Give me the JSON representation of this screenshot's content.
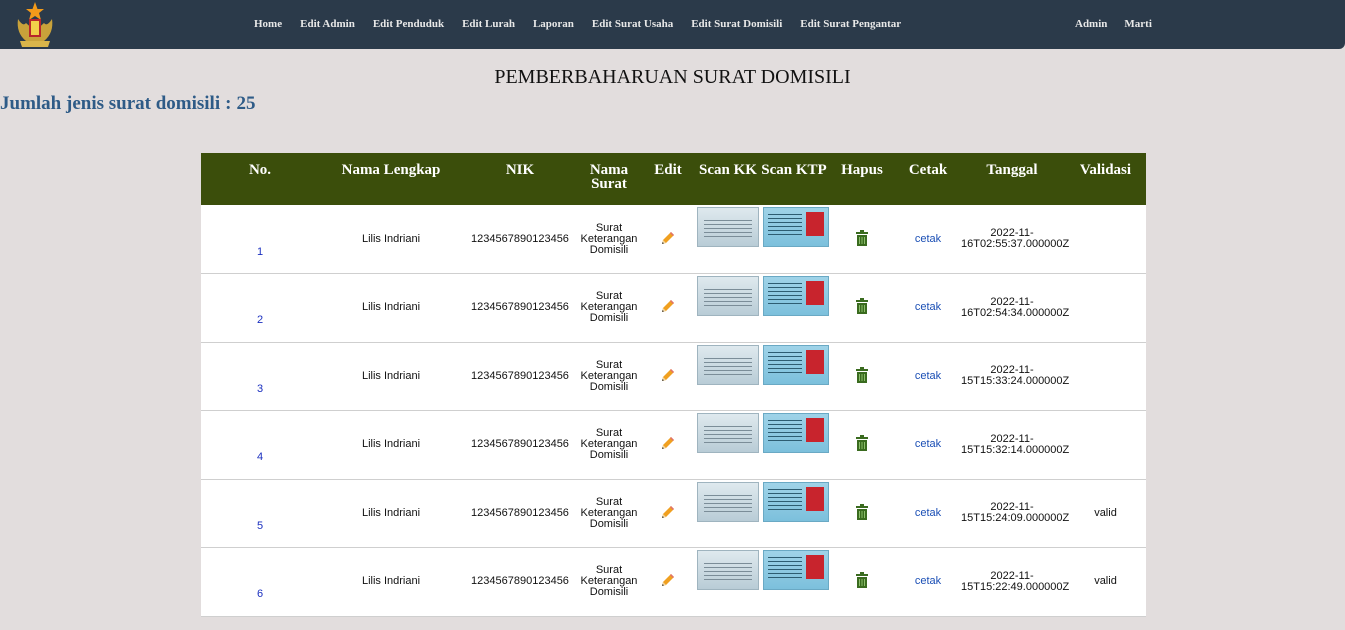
{
  "nav": {
    "items": [
      "Home",
      "Edit Admin",
      "Edit Penduduk",
      "Edit Lurah",
      "Laporan",
      "Edit Surat Usaha",
      "Edit Surat Domisili",
      "Edit Surat Pengantar"
    ],
    "right": [
      "Admin",
      "Marti"
    ]
  },
  "page": {
    "title": "PEMBERBAHARUAN SURAT DOMISILI",
    "count_label": "Jumlah jenis surat domisili",
    "count_sep": ":",
    "count_value": "25"
  },
  "table": {
    "headers": [
      "No.",
      "Nama Lengkap",
      "NIK",
      "Nama Surat",
      "Edit",
      "Scan KK",
      "Scan KTP",
      "Hapus",
      "Cetak",
      "Tanggal",
      "Validasi"
    ],
    "rows": [
      {
        "no": "1",
        "nama": "Lilis Indriani",
        "nik": "1234567890123456",
        "surat": "Surat Keterangan Domisili",
        "cetak": "cetak",
        "tanggal": "2022-11-16T02:55:37.000000Z",
        "validasi": ""
      },
      {
        "no": "2",
        "nama": "Lilis Indriani",
        "nik": "1234567890123456",
        "surat": "Surat Keterangan Domisili",
        "cetak": "cetak",
        "tanggal": "2022-11-16T02:54:34.000000Z",
        "validasi": ""
      },
      {
        "no": "3",
        "nama": "Lilis Indriani",
        "nik": "1234567890123456",
        "surat": "Surat Keterangan Domisili",
        "cetak": "cetak",
        "tanggal": "2022-11-15T15:33:24.000000Z",
        "validasi": ""
      },
      {
        "no": "4",
        "nama": "Lilis Indriani",
        "nik": "1234567890123456",
        "surat": "Surat Keterangan Domisili",
        "cetak": "cetak",
        "tanggal": "2022-11-15T15:32:14.000000Z",
        "validasi": ""
      },
      {
        "no": "5",
        "nama": "Lilis Indriani",
        "nik": "1234567890123456",
        "surat": "Surat Keterangan Domisili",
        "cetak": "cetak",
        "tanggal": "2022-11-15T15:24:09.000000Z",
        "validasi": "valid"
      },
      {
        "no": "6",
        "nama": "Lilis Indriani",
        "nik": "1234567890123456",
        "surat": "Surat Keterangan Domisili",
        "cetak": "cetak",
        "tanggal": "2022-11-15T15:22:49.000000Z",
        "validasi": "valid"
      }
    ]
  },
  "colors": {
    "navbar": "#2b3a4a",
    "header": "#3b4e0b",
    "background": "#e2dddd",
    "count": "#2e5b87"
  },
  "icons": {
    "logo": "emblem-logo",
    "edit": "pencil-icon",
    "delete": "trash-icon"
  }
}
